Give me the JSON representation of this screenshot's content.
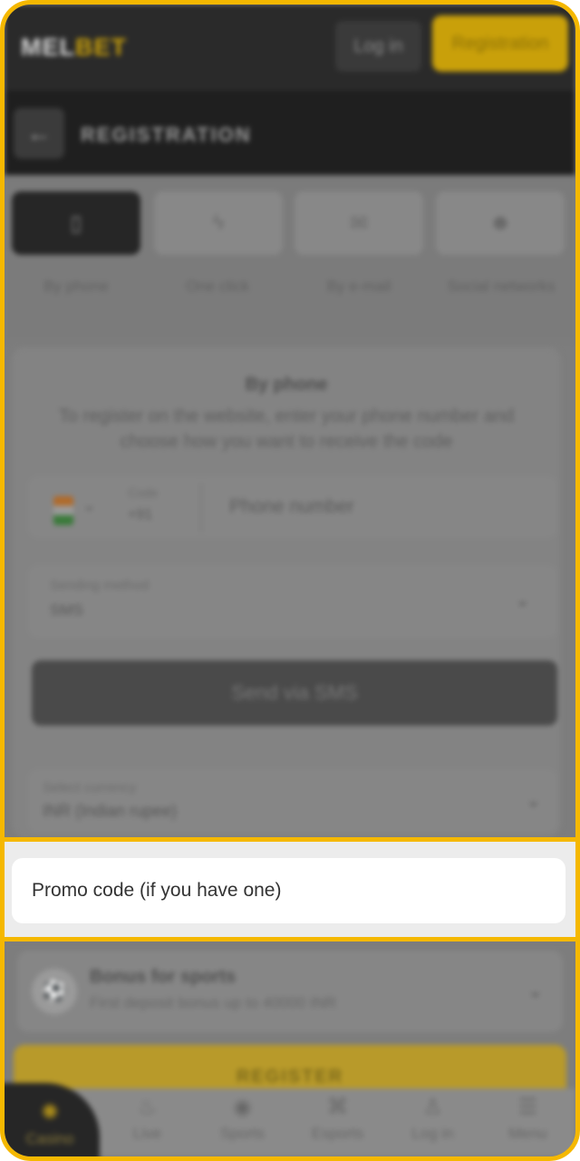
{
  "header": {
    "logo_left": "MEL",
    "logo_right": "BET",
    "login_label": "Log in",
    "register_label": "Registration"
  },
  "subheader": {
    "back_icon": "arrow-left-icon",
    "title": "REGISTRATION"
  },
  "tabs": [
    {
      "label": "By phone",
      "icon": "phone-icon",
      "glyph": "▯",
      "active": true
    },
    {
      "label": "One click",
      "icon": "lightning-icon",
      "glyph": "ϟ",
      "active": false
    },
    {
      "label": "By e-mail",
      "icon": "envelope-icon",
      "glyph": "✉",
      "active": false
    },
    {
      "label": "Social networks",
      "icon": "social-icon",
      "glyph": "☻",
      "active": false
    }
  ],
  "form": {
    "title": "By phone",
    "description": "To register on the website, enter your phone number and choose how you want to receive the code",
    "code_label": "Code",
    "code_value": "+91",
    "phone_placeholder": "Phone number",
    "sending_method_label": "Sending method",
    "sending_method_value": "SMS",
    "send_button": "Send via SMS",
    "currency_label": "Select currency",
    "currency_value": "INR (Indian rupee)"
  },
  "promo": {
    "placeholder": "Promo code (if you have one)"
  },
  "bonus": {
    "title": "Bonus for sports",
    "subtitle": "First deposit bonus up to 40000 INR"
  },
  "register_button": "REGISTER",
  "bottom_nav": [
    {
      "label": "Casino",
      "icon": "casino-icon",
      "glyph": "✺"
    },
    {
      "label": "Live",
      "icon": "flame-icon",
      "glyph": "♨"
    },
    {
      "label": "Sports",
      "icon": "ball-icon",
      "glyph": "◉"
    },
    {
      "label": "Esports",
      "icon": "gamepad-icon",
      "glyph": "⌘"
    },
    {
      "label": "Log in",
      "icon": "user-icon",
      "glyph": "♙"
    },
    {
      "label": "Menu",
      "icon": "menu-icon",
      "glyph": "☰"
    }
  ],
  "colors": {
    "accent": "#f5b800",
    "dark": "#262626"
  }
}
